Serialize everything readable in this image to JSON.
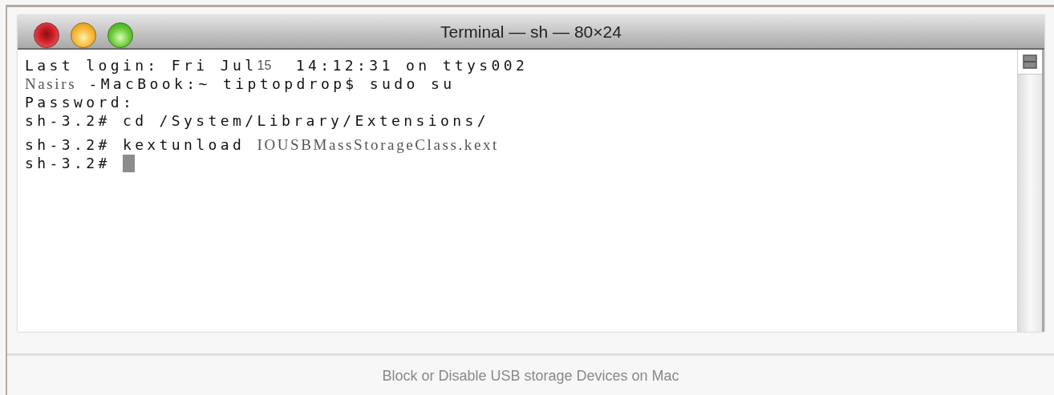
{
  "window": {
    "title": "Terminal — sh — 80×24"
  },
  "terminal": {
    "lines": [
      {
        "segments": [
          {
            "kind": "mono",
            "text": "Last login: Fri Jul"
          },
          {
            "kind": "sans",
            "text": "15"
          },
          {
            "kind": "mono",
            "text": "  14:12:31 on ttys002"
          }
        ],
        "cursor": false
      },
      {
        "segments": [
          {
            "kind": "serif",
            "text": "Nasirs"
          },
          {
            "kind": "mono",
            "text": " -MacBook:~ tiptopdrop$ sudo su"
          }
        ],
        "cursor": false
      },
      {
        "segments": [
          {
            "kind": "mono",
            "text": "Password:"
          }
        ],
        "cursor": false
      },
      {
        "segments": [
          {
            "kind": "mono",
            "text": "sh-3.2# cd /System/Library/Extensions/"
          }
        ],
        "cursor": false
      },
      {
        "segments": [
          {
            "kind": "mono",
            "text": "sh-3.2# kextunload "
          },
          {
            "kind": "serif",
            "text": "IOUSBMassStorageClass.kext"
          }
        ],
        "cursor": false
      },
      {
        "segments": [
          {
            "kind": "mono",
            "text": "sh-3.2# "
          }
        ],
        "cursor": true
      }
    ]
  },
  "caption": "Block or Disable USB storage Devices on Mac"
}
